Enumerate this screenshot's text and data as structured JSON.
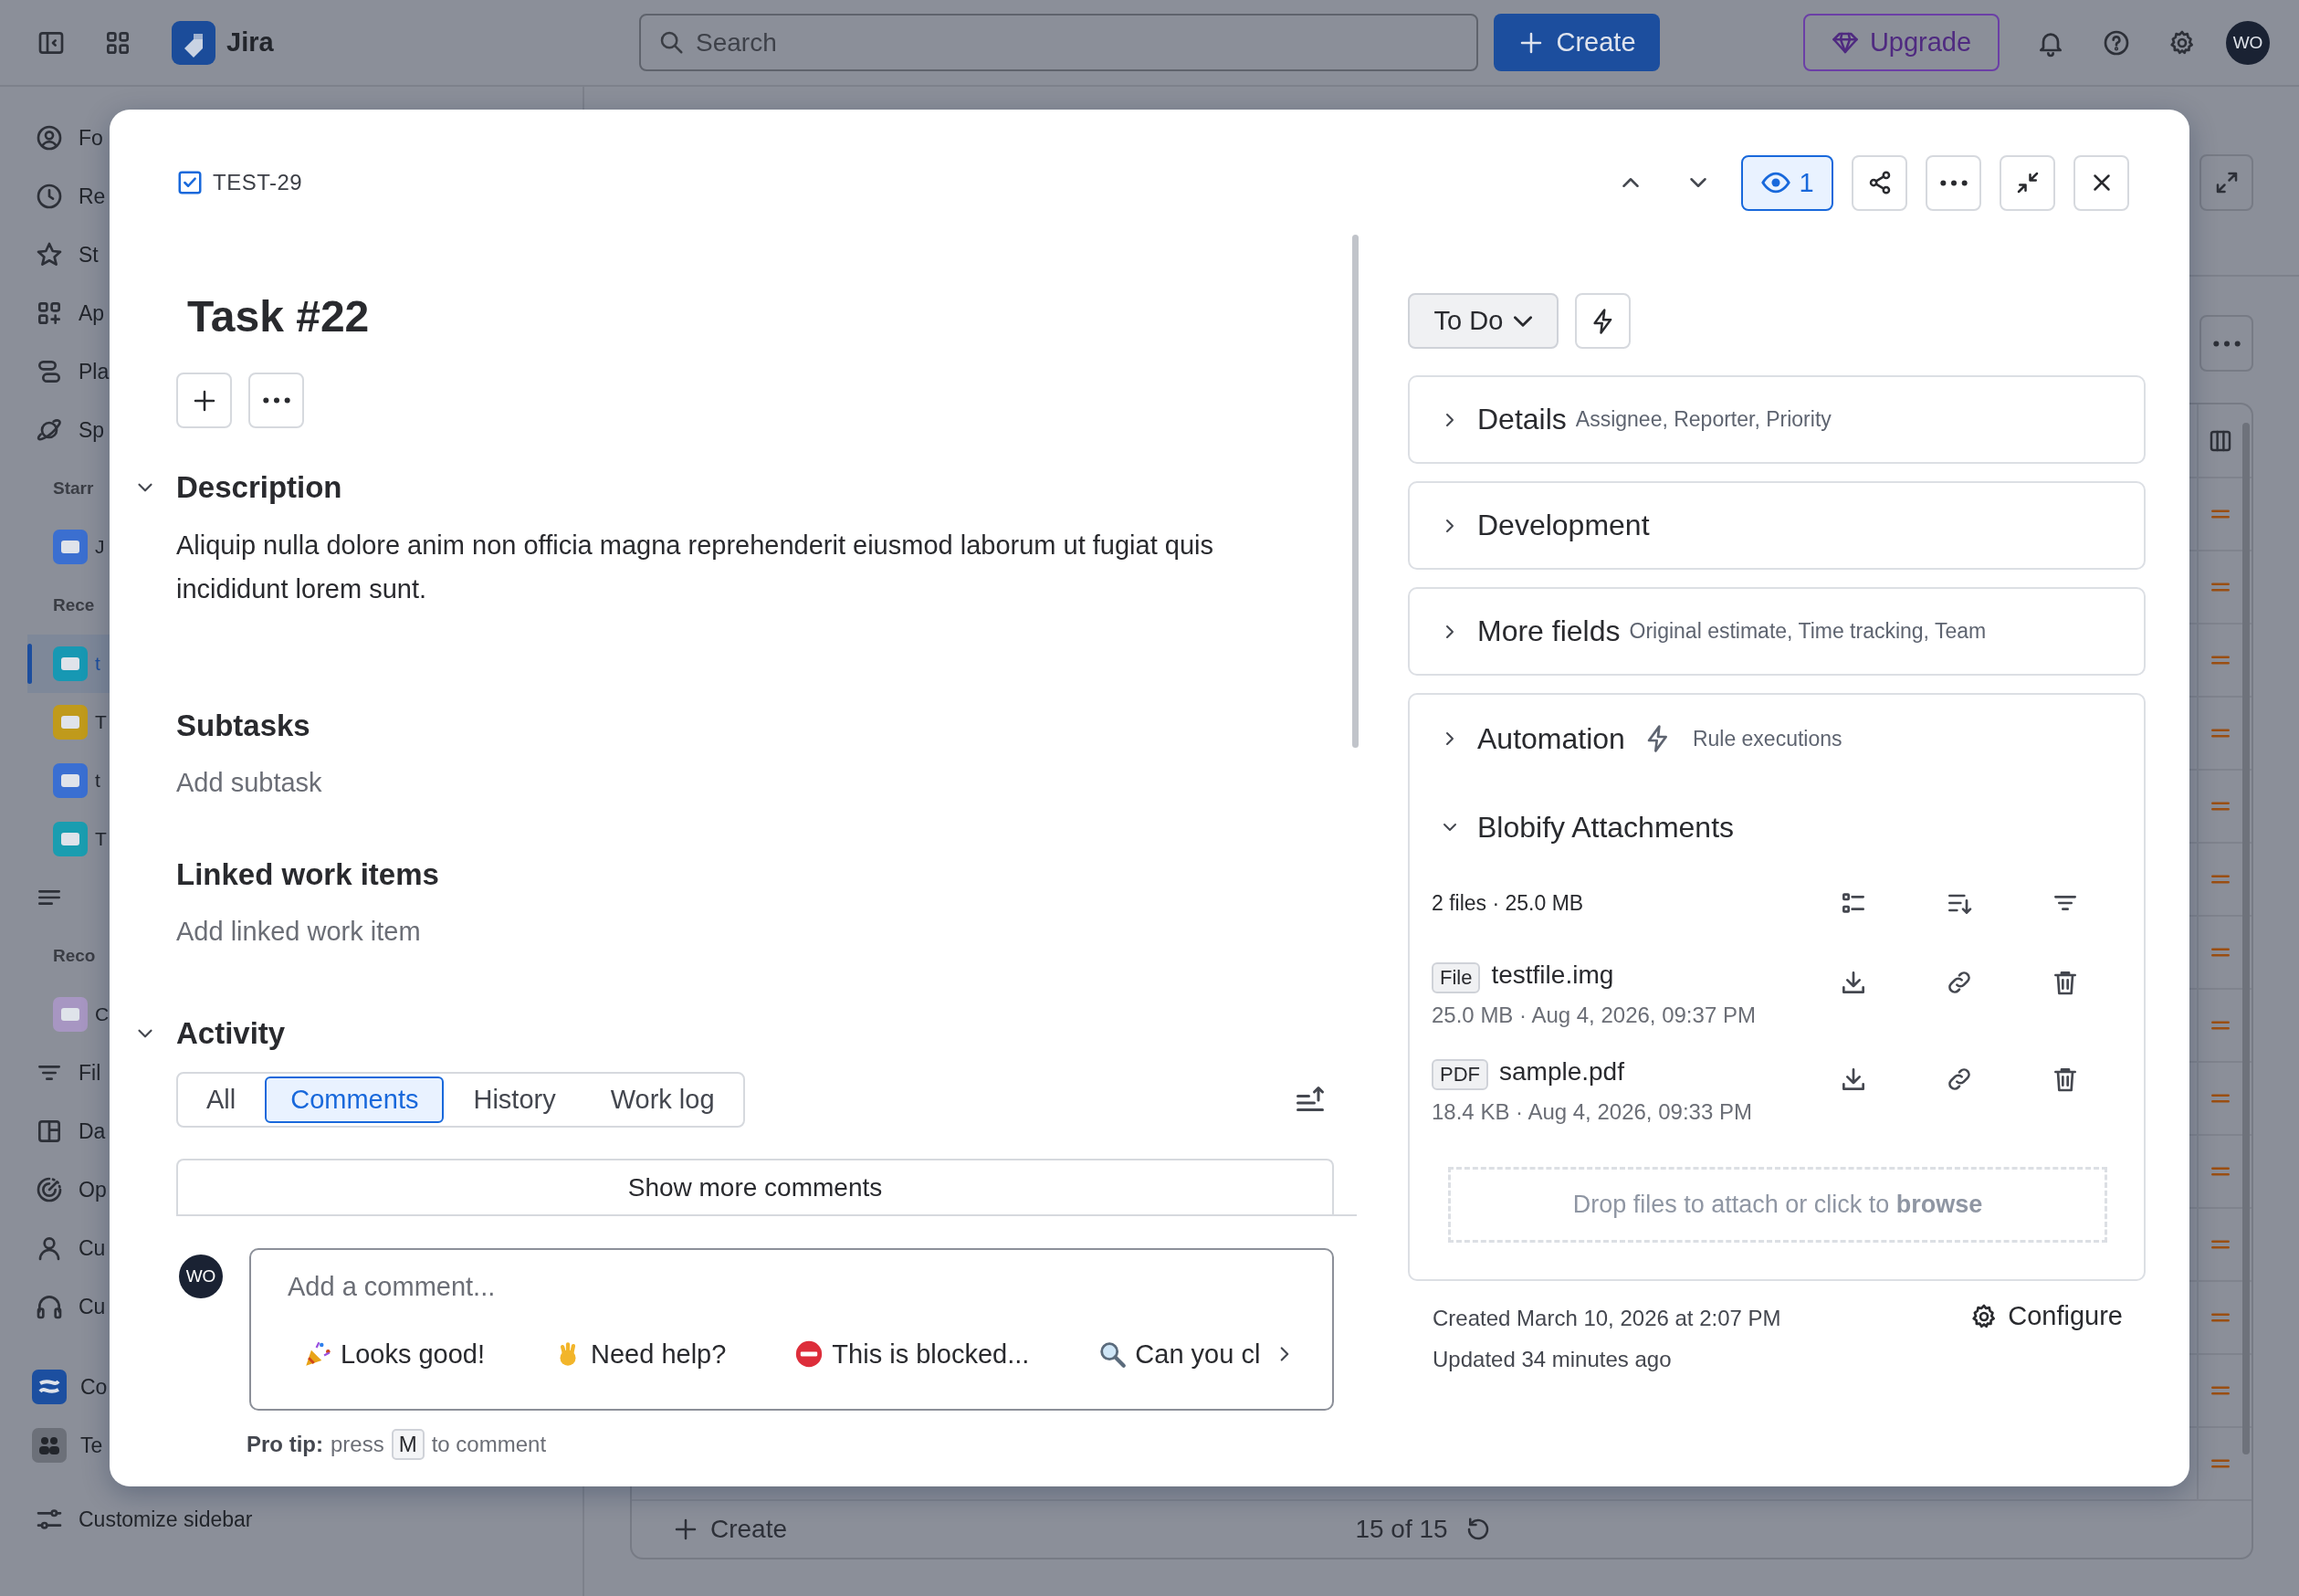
{
  "topbar": {
    "product": "Jira",
    "search_placeholder": "Search",
    "create": "Create",
    "upgrade": "Upgrade",
    "avatar": "WO"
  },
  "sidebar": {
    "items": [
      {
        "kind": "item",
        "label": "Fo",
        "selected": false
      },
      {
        "kind": "item",
        "label": "Re",
        "selected": false
      },
      {
        "kind": "item",
        "label": "St",
        "selected": false
      },
      {
        "kind": "item",
        "label": "Ap",
        "selected": false
      },
      {
        "kind": "item",
        "label": "Pla",
        "selected": false
      },
      {
        "kind": "item",
        "label": "Sp",
        "selected": false
      },
      {
        "kind": "heading",
        "label": "Starr"
      },
      {
        "kind": "project",
        "label": "J",
        "selected": false,
        "color": "#3b6fd0"
      },
      {
        "kind": "heading",
        "label": "Rece"
      },
      {
        "kind": "project",
        "label": "t",
        "selected": true,
        "color": "#1798b3"
      },
      {
        "kind": "project",
        "label": "T",
        "selected": false,
        "color": "#c09a1b"
      },
      {
        "kind": "project",
        "label": "t",
        "selected": false,
        "color": "#3a6fd2"
      },
      {
        "kind": "project",
        "label": "T",
        "selected": false,
        "color": "#1a9db0"
      },
      {
        "kind": "item",
        "selected": false
      },
      {
        "kind": "heading",
        "label": "Reco"
      },
      {
        "kind": "project",
        "label": "C",
        "selected": false,
        "color": "#a796c2"
      },
      {
        "kind": "item",
        "label": "Fil",
        "selected": false
      },
      {
        "kind": "item",
        "label": "Da",
        "selected": false
      },
      {
        "kind": "item",
        "label": "Op",
        "selected": false
      },
      {
        "kind": "item",
        "label": "Cu",
        "selected": false
      },
      {
        "kind": "item",
        "label": "Cu",
        "selected": false
      }
    ],
    "apps": [
      {
        "label": "Co",
        "color": "#1c4fa0"
      },
      {
        "label": "Te",
        "color": "#6c7079"
      }
    ],
    "customize": "Customize sidebar"
  },
  "board": {
    "create": "Create",
    "count": "15 of 15"
  },
  "issue": {
    "key": "TEST-29",
    "title": "Task #22",
    "watching": true,
    "watchers": "1",
    "description": {
      "heading": "Description",
      "expanded": true,
      "text": "Aliquip nulla dolore anim non officia magna reprehenderit eiusmod laborum ut fugiat quis incididunt lorem sunt."
    },
    "subtasks": {
      "heading": "Subtasks",
      "placeholder": "Add subtask"
    },
    "linked": {
      "heading": "Linked work items",
      "placeholder": "Add linked work item"
    },
    "activity": {
      "heading": "Activity",
      "expanded": true,
      "tabs": [
        {
          "label": "All",
          "selected": false
        },
        {
          "label": "Comments",
          "selected": true
        },
        {
          "label": "History",
          "selected": false
        },
        {
          "label": "Work log",
          "selected": false
        }
      ],
      "show_more": "Show more comments",
      "avatar": "WO",
      "comment_placeholder": "Add a comment...",
      "suggestions": [
        "Looks good!",
        "Need help?",
        "This is blocked...",
        "Can you cl"
      ],
      "pro_tip": {
        "lead": "Pro tip:",
        "before": "press",
        "key": "M",
        "after": "to comment"
      }
    },
    "status": "To Do",
    "panels": [
      {
        "title": "Details",
        "subtitle": "Assignee, Reporter, Priority",
        "expanded": false
      },
      {
        "title": "Development",
        "expanded": false
      },
      {
        "title": "More fields",
        "subtitle": "Original estimate, Time tracking, Team",
        "expanded": false
      }
    ],
    "automation": {
      "title": "Automation",
      "subtitle": "Rule executions",
      "expanded": false
    },
    "attachments": {
      "title": "Blobify Attachments",
      "expanded": true,
      "summary": "2 files · 25.0 MB",
      "files": [
        {
          "type": "File",
          "name": "testfile.img",
          "meta": "25.0 MB · Aug 4, 2026, 09:37 PM"
        },
        {
          "type": "PDF",
          "name": "sample.pdf",
          "meta": "18.4 KB · Aug 4, 2026, 09:33 PM"
        }
      ],
      "dropzone": "Drop files to attach or click to **browse**"
    },
    "created": "Created March 10, 2026 at 2:07 PM",
    "updated": "Updated 34 minutes ago",
    "configure": "Configure"
  }
}
